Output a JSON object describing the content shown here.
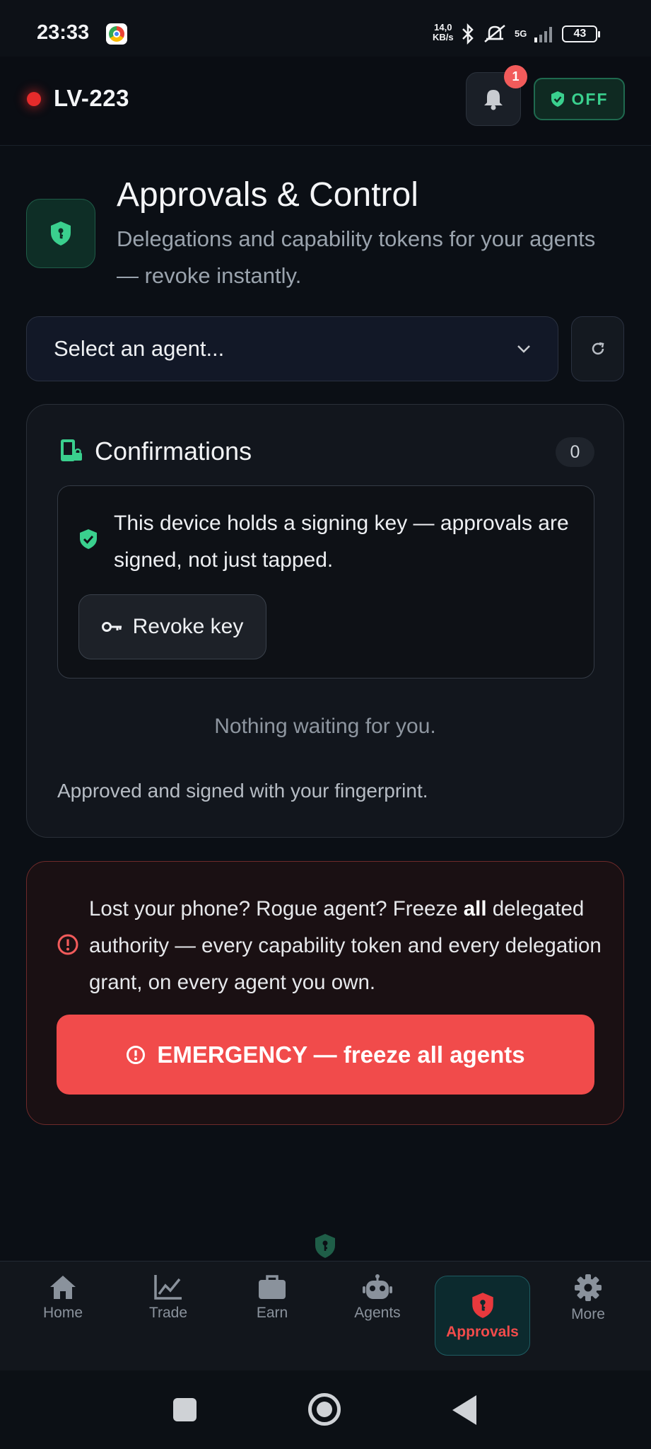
{
  "status_bar": {
    "time": "23:33",
    "net_speed_value": "14,0",
    "net_speed_unit": "KB/s",
    "network": "5G",
    "battery": "43"
  },
  "header": {
    "device_name": "LV-223",
    "notification_count": "1",
    "toggle_label": "OFF"
  },
  "page": {
    "title": "Approvals & Control",
    "subtitle": "Delegations and capability tokens for your agents — revoke instantly."
  },
  "agent_select": {
    "placeholder": "Select an agent..."
  },
  "confirmations": {
    "title": "Confirmations",
    "count": "0",
    "signing_key_text": "This device holds a signing key — approvals are signed, not just tapped.",
    "revoke_label": "Revoke key",
    "empty_text": "Nothing waiting for you.",
    "footer_text": "Approved and signed with your fingerprint."
  },
  "emergency": {
    "text_before": "Lost your phone? Rogue agent? Freeze ",
    "text_bold": "all",
    "text_after": " delegated authority — every capability token and every delegation grant, on every agent you own.",
    "button_label": "EMERGENCY — freeze all agents"
  },
  "tabs": [
    {
      "label": "Home",
      "icon": "home-icon"
    },
    {
      "label": "Trade",
      "icon": "chart-icon"
    },
    {
      "label": "Earn",
      "icon": "briefcase-icon"
    },
    {
      "label": "Agents",
      "icon": "robot-icon"
    },
    {
      "label": "Approvals",
      "icon": "shield-key-icon"
    },
    {
      "label": "More",
      "icon": "gear-icon"
    }
  ],
  "colors": {
    "accent_green": "#3ad08e",
    "danger_red": "#f14b4b",
    "background": "#0b0f15"
  }
}
